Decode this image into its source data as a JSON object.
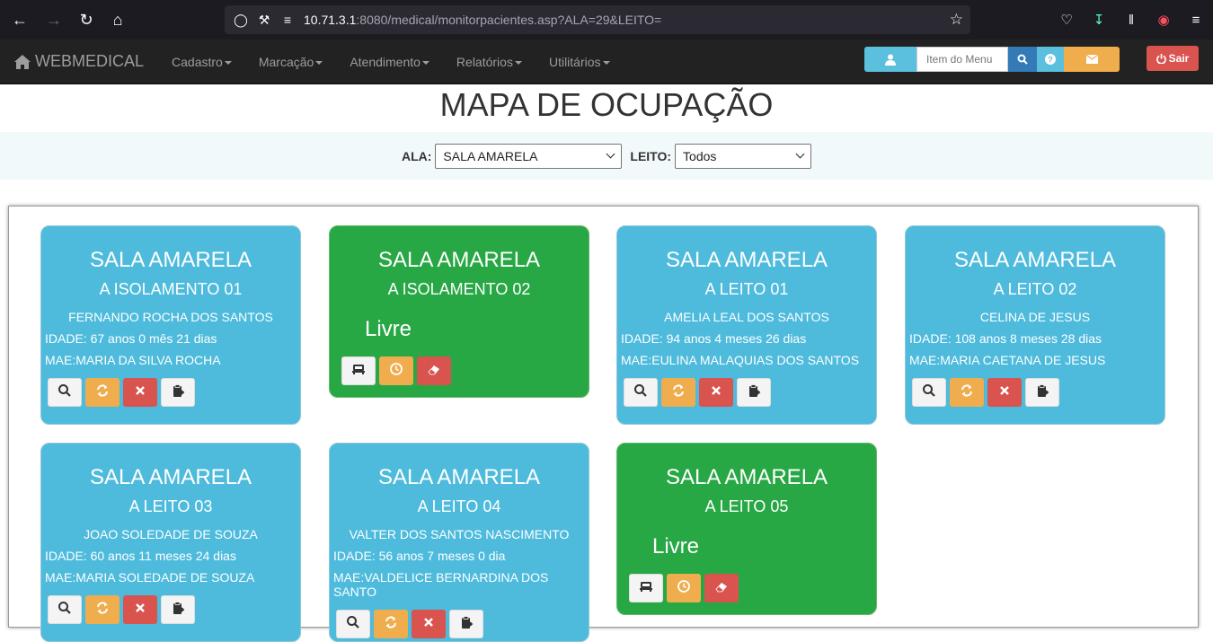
{
  "browser": {
    "url_main": "10.71.3.1",
    "url_rest": ":8080/medical/monitorpacientes.asp?ALA=29&LEITO="
  },
  "navbar": {
    "brand": "WEBMEDICAL",
    "menu": [
      "Cadastro",
      "Marcação",
      "Atendimento",
      "Relatórios",
      "Utilitários"
    ],
    "search_placeholder": "Item do Menu",
    "logout_label": "Sair"
  },
  "page": {
    "title": "MAPA DE OCUPAÇÃO",
    "ala_label": "ALA:",
    "ala_value": "SALA AMARELA",
    "leito_label": "LEITO:",
    "leito_value": "Todos"
  },
  "beds": [
    {
      "sala": "SALA AMARELA",
      "leito": "A ISOLAMENTO 01",
      "status": "occupied",
      "patient": "FERNANDO ROCHA DOS SANTOS",
      "idade": "IDADE: 67 anos 0 mês 21 dias",
      "mae": "MAE:MARIA DA SILVA ROCHA"
    },
    {
      "sala": "SALA AMARELA",
      "leito": "A ISOLAMENTO 02",
      "status": "free",
      "livre": "Livre"
    },
    {
      "sala": "SALA AMARELA",
      "leito": "A LEITO 01",
      "status": "occupied",
      "patient": "AMELIA LEAL DOS SANTOS",
      "idade": "IDADE: 94 anos 4 meses 26 dias",
      "mae": "MAE:EULINA MALAQUIAS DOS SANTOS"
    },
    {
      "sala": "SALA AMARELA",
      "leito": "A LEITO 02",
      "status": "occupied",
      "patient": "CELINA DE JESUS",
      "idade": "IDADE: 108 anos 8 meses 28 dias",
      "mae": "MAE:MARIA CAETANA DE JESUS"
    },
    {
      "sala": "SALA AMARELA",
      "leito": "A LEITO 03",
      "status": "occupied",
      "patient": "JOAO SOLEDADE DE SOUZA",
      "idade": "IDADE: 60 anos 11 meses 24 dias",
      "mae": "MAE:MARIA SOLEDADE DE SOUZA"
    },
    {
      "sala": "SALA AMARELA",
      "leito": "A LEITO 04",
      "status": "occupied",
      "patient": "VALTER DOS SANTOS NASCIMENTO",
      "idade": "IDADE: 56 anos 7 meses 0 dia",
      "mae": "MAE:VALDELICE BERNARDINA DOS SANTO"
    },
    {
      "sala": "SALA AMARELA",
      "leito": "A LEITO 05",
      "status": "free",
      "livre": "Livre"
    }
  ]
}
